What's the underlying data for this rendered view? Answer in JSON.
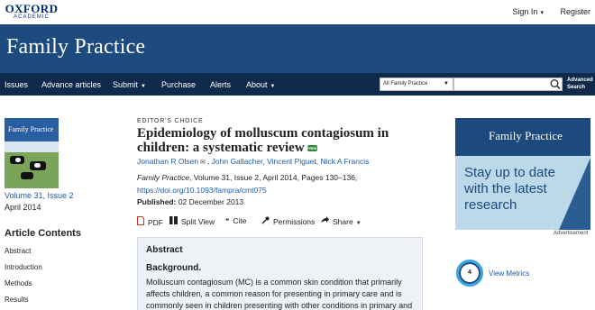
{
  "header": {
    "logo_line1": "OXFORD",
    "logo_line2": "ACADEMIC",
    "sign_in": "Sign In",
    "register": "Register"
  },
  "journal": {
    "title": "Family Practice"
  },
  "nav": {
    "items": [
      "Issues",
      "Advance articles",
      "Submit",
      "Purchase",
      "Alerts",
      "About"
    ],
    "search_scope": "All Family Practice",
    "search_placeholder": "",
    "advanced_line1": "Advanced",
    "advanced_line2": "Search"
  },
  "sidebar": {
    "cover_title": "Family Practice",
    "volume_link": "Volume 31, Issue 2",
    "date": "April 2014",
    "toc_heading": "Article Contents",
    "toc_items": [
      "Abstract",
      "Introduction",
      "Methods",
      "Results"
    ]
  },
  "article": {
    "label": "EDITOR'S CHOICE",
    "title": "Epidemiology of molluscum contagiosum in children: a systematic review",
    "free_badge": "FREE",
    "authors": [
      "Jonathan R Olsen",
      "John Gallacher",
      "Vincent Piguet",
      "Nick A Francis"
    ],
    "citation_journal": "Family Practice",
    "citation_rest": ", Volume 31, Issue 2, April 2014, Pages 130–136,",
    "doi": "https://doi.org/10.1093/fampra/cmt075",
    "published_label": "Published:",
    "published_date": "02 December 2013"
  },
  "toolbar": {
    "pdf": "PDF",
    "split_view": "Split View",
    "cite": "Cite",
    "permissions": "Permissions",
    "share": "Share"
  },
  "abstract": {
    "heading": "Abstract",
    "subheading": "Background.",
    "text": "Molluscum contagiosum (MC) is a common skin condition that primarily affects children, a common reason for presenting in primary care and is commonly seen in children presenting with other conditions in primary and"
  },
  "ad": {
    "title": "Family Practice",
    "tagline": "Stay up to date with the latest research",
    "label": "Advertisement"
  },
  "metrics": {
    "count": "4",
    "link": "View Metrics"
  },
  "colors": {
    "banner": "#1d4b7f",
    "nav": "#0f2a4a",
    "link": "#1e5aa8"
  }
}
